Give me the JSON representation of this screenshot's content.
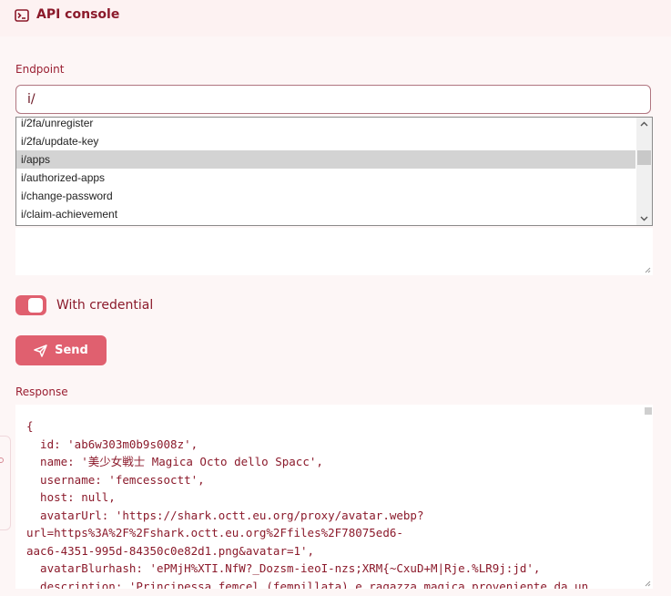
{
  "header": {
    "title": "API console",
    "icon": "terminal-icon"
  },
  "endpoint": {
    "label": "Endpoint",
    "value": "i/"
  },
  "suggestions": {
    "items": [
      "i/2fa/unregister",
      "i/2fa/update-key",
      "i/apps",
      "i/authorized-apps",
      "i/change-password",
      "i/claim-achievement"
    ],
    "selected": "i/apps"
  },
  "credential": {
    "label": "With credential",
    "enabled": true
  },
  "send": {
    "label": "Send",
    "icon": "send-icon"
  },
  "response": {
    "label": "Response",
    "lines": [
      "{",
      "  id: 'ab6w303m0b9s008z',",
      "  name: '美少女戦士 Magica Octo dello Spacc',",
      "  username: 'femcessoctt',",
      "  host: null,",
      "  avatarUrl: 'https://shark.octt.eu.org/proxy/avatar.webp?",
      "url=https%3A%2F%2Fshark.octt.eu.org%2Ffiles%2F78075ed6-",
      "aac6-4351-995d-84350c0e82d1.png&avatar=1',",
      "  avatarBlurhash: 'ePMjH%XTI.NfW?_Dozsm-ieoI-nzs;XRM{~CxuD+M|Rje.%LR9j:jd',",
      "  description: 'Principessa femcel (fempillata) e ragazza magica proveniente da un"
    ]
  },
  "colors": {
    "accent": "#e0606f",
    "text": "#8b1a2b",
    "background": "#fdf6f6"
  }
}
